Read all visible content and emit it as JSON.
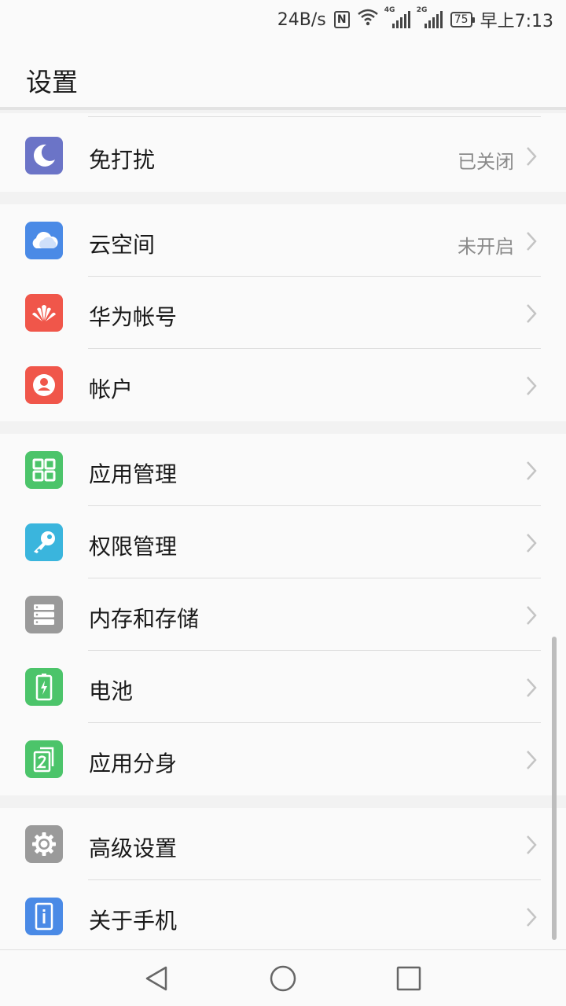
{
  "status_bar": {
    "speed": "24B/s",
    "nfc": "N",
    "net1": "4G",
    "net2": "2G",
    "battery": "75",
    "time": "早上7:13"
  },
  "header": {
    "title": "设置"
  },
  "groups": [
    [
      {
        "label": "免打扰",
        "value": "已关闭",
        "icon": "moon-icon",
        "color": "#6b74c7"
      }
    ],
    [
      {
        "label": "云空间",
        "value": "未开启",
        "icon": "cloud-icon",
        "color": "#4a8ae6"
      },
      {
        "label": "华为帐号",
        "value": "",
        "icon": "huawei-logo-icon",
        "color": "#f0564a"
      },
      {
        "label": "帐户",
        "value": "",
        "icon": "account-icon",
        "color": "#f0564a"
      }
    ],
    [
      {
        "label": "应用管理",
        "value": "",
        "icon": "apps-grid-icon",
        "color": "#4cc46a"
      },
      {
        "label": "权限管理",
        "value": "",
        "icon": "key-icon",
        "color": "#3ab5dd"
      },
      {
        "label": "内存和存储",
        "value": "",
        "icon": "storage-icon",
        "color": "#9a9a9a"
      },
      {
        "label": "电池",
        "value": "",
        "icon": "battery-icon",
        "color": "#4cc46a"
      },
      {
        "label": "应用分身",
        "value": "",
        "icon": "app-twin-icon",
        "color": "#4cc46a"
      }
    ],
    [
      {
        "label": "高级设置",
        "value": "",
        "icon": "gear-icon",
        "color": "#9a9a9a"
      },
      {
        "label": "关于手机",
        "value": "",
        "icon": "phone-info-icon",
        "color": "#4a8ae6"
      }
    ]
  ],
  "nav": {
    "back": "back-icon",
    "home": "home-icon",
    "recents": "recents-icon"
  }
}
